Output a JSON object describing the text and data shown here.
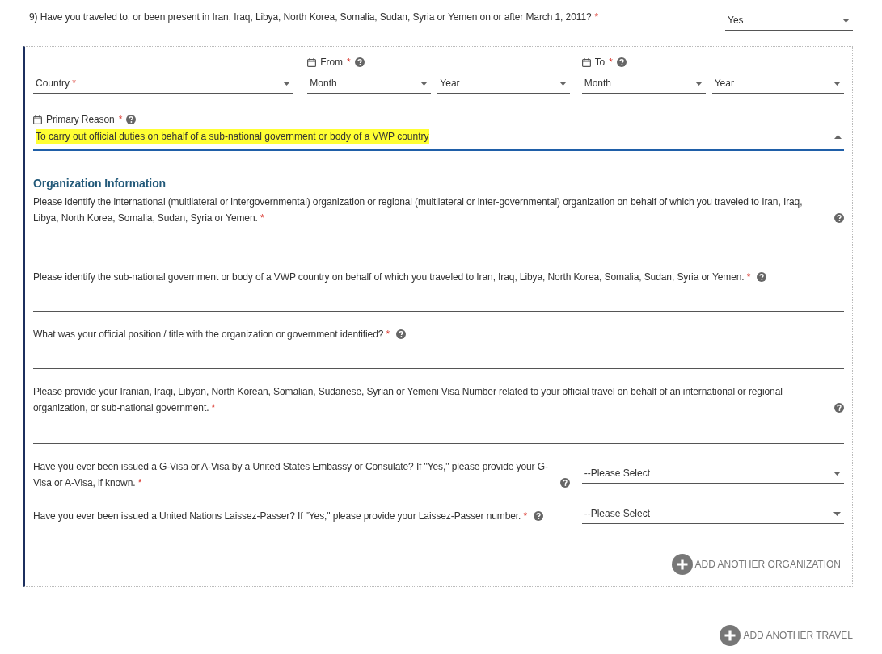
{
  "question": {
    "text": "9) Have you traveled to, or been present in Iran, Iraq, Libya, North Korea, Somalia, Sudan, Syria or Yemen on or after March 1, 2011?",
    "mark": "*",
    "answer": "Yes"
  },
  "travel": {
    "country": {
      "label": "Country",
      "mark": "*"
    },
    "periods": [
      {
        "label": "From",
        "mark": "*",
        "month": "Month",
        "year": "Year"
      },
      {
        "label": "To",
        "mark": "*",
        "month": "Month",
        "year": "Year"
      }
    ],
    "primary_reason": {
      "label": "Primary Reason",
      "mark": "*",
      "value": "To carry out official duties on behalf of a sub-national government or body of a VWP country",
      "highlighted": true,
      "expanded": true
    },
    "organization": {
      "heading": "Organization Information",
      "questions": [
        {
          "kind": "text",
          "label": "Please identify the international (multilateral or intergovernmental) organization or regional (multilateral or inter-governmental) organization on behalf of which you traveled to Iran, Iraq, Libya, North Korea, Somalia, Sudan, Syria or Yemen.",
          "mark": "*"
        },
        {
          "kind": "text",
          "label": "Please identify the sub-national government or body of a VWP country on behalf of which you traveled to Iran, Iraq, Libya, North Korea, Somalia, Sudan, Syria or Yemen.",
          "mark": "*"
        },
        {
          "kind": "text",
          "label": "What was your official position / title with the organization or government identified?",
          "mark": "*"
        },
        {
          "kind": "text",
          "label": "Please provide your Iranian, Iraqi, Libyan, North Korean, Somalian, Sudanese, Syrian or Yemeni Visa Number related to your official travel on behalf of an international or regional organization, or sub-national government.",
          "mark": "*"
        },
        {
          "kind": "select",
          "label": "Have you ever been issued a G-Visa or A-Visa by a United States Embassy or Consulate? If \"Yes,\" please provide your G-Visa or A-Visa, if known.",
          "mark": "*",
          "value": "--Please Select"
        },
        {
          "kind": "select",
          "label": "Have you ever been issued a United Nations Laissez-Passer? If \"Yes,\" please provide your Laissez-Passer number.",
          "mark": "*",
          "value": "--Please Select"
        }
      ],
      "add_button": "ADD ANOTHER ORGANIZATION"
    }
  },
  "add_travel_button": "ADD ANOTHER TRAVEL"
}
